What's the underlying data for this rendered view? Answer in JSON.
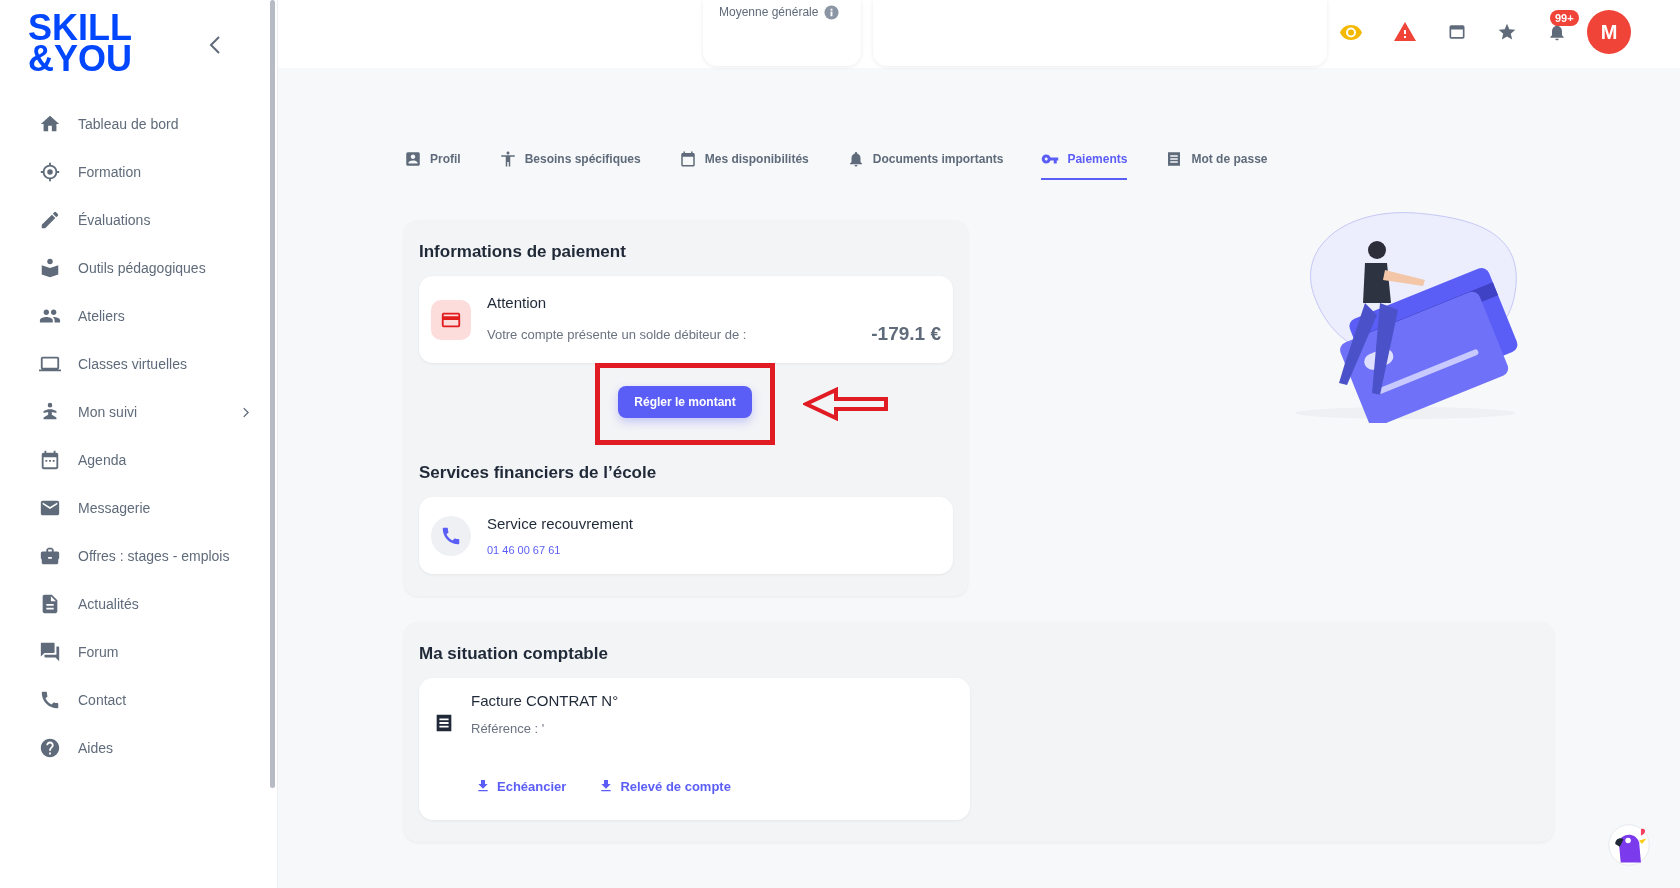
{
  "logo": {
    "line1": "SKILL",
    "line2": "&YOU"
  },
  "sidebar": {
    "items": [
      {
        "label": "Tableau de bord",
        "has_submenu": false
      },
      {
        "label": "Formation",
        "has_submenu": false
      },
      {
        "label": "Évaluations",
        "has_submenu": false
      },
      {
        "label": "Outils pédagogiques",
        "has_submenu": false
      },
      {
        "label": "Ateliers",
        "has_submenu": false
      },
      {
        "label": "Classes virtuelles",
        "has_submenu": false
      },
      {
        "label": "Mon suivi",
        "has_submenu": true
      },
      {
        "label": "Agenda",
        "has_submenu": false
      },
      {
        "label": "Messagerie",
        "has_submenu": false
      },
      {
        "label": "Offres : stages - emplois",
        "has_submenu": false
      },
      {
        "label": "Actualités",
        "has_submenu": false
      },
      {
        "label": "Forum",
        "has_submenu": false
      },
      {
        "label": "Contact",
        "has_submenu": false
      },
      {
        "label": "Aides",
        "has_submenu": false
      }
    ]
  },
  "header": {
    "average_label": "Moyenne générale",
    "notification_badge": "99+",
    "avatar_initial": "M"
  },
  "tabs": [
    {
      "label": "Profil",
      "selected": false
    },
    {
      "label": "Besoins spécifiques",
      "selected": false
    },
    {
      "label": "Mes disponibilités",
      "selected": false
    },
    {
      "label": "Documents importants",
      "selected": false
    },
    {
      "label": "Paiements",
      "selected": true
    },
    {
      "label": "Mot de passe",
      "selected": false
    }
  ],
  "payment": {
    "title": "Informations de paiement",
    "alert_title": "Attention",
    "alert_text": "Votre compte présente un solde débiteur de :",
    "amount": "-179.1 €",
    "pay_button": "Régler le montant"
  },
  "services": {
    "title": "Services financiers de l’école",
    "name": "Service recouvrement",
    "phone": "01 46 00 67 61"
  },
  "accounting": {
    "title": "Ma situation comptable",
    "invoice_title": "Facture CONTRAT N°",
    "reference": "Référence : '",
    "links": [
      "Echéancier",
      "Relevé de compte"
    ]
  }
}
